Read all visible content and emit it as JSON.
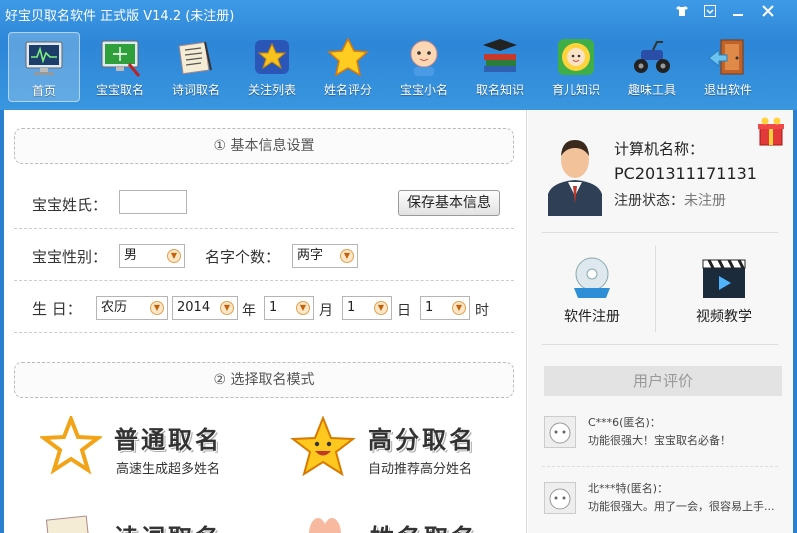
{
  "window": {
    "title": "好宝贝取名软件  正式版 V14.2  (未注册)",
    "controls": [
      "shirt-icon",
      "menu-icon",
      "minimize-icon",
      "close-icon"
    ]
  },
  "toolbar": [
    {
      "label": "首页",
      "icon": "monitor-chart-icon",
      "active": true
    },
    {
      "label": "宝宝取名",
      "icon": "monitor-pen-icon",
      "active": false
    },
    {
      "label": "诗词取名",
      "icon": "scroll-pen-icon",
      "active": false
    },
    {
      "label": "关注列表",
      "icon": "star-badge-icon",
      "active": false
    },
    {
      "label": "姓名评分",
      "icon": "gold-star-icon",
      "active": false
    },
    {
      "label": "宝宝小名",
      "icon": "baby-face-icon",
      "active": false
    },
    {
      "label": "取名知识",
      "icon": "books-icon",
      "active": false
    },
    {
      "label": "育儿知识",
      "icon": "sunflower-baby-icon",
      "active": false
    },
    {
      "label": "趣味工具",
      "icon": "atv-icon",
      "active": false
    },
    {
      "label": "退出软件",
      "icon": "exit-door-icon",
      "active": false
    }
  ],
  "basic": {
    "section_title": "① 基本信息设置",
    "surname_label": "宝宝姓氏：",
    "surname_value": "",
    "save_button": "保存基本信息",
    "gender_label": "宝宝性别：",
    "gender_value": "男",
    "name_count_label": "名字个数：",
    "name_count_value": "两字",
    "birth_label": "生 日：",
    "calendar_value": "农历",
    "year_value": "2014",
    "year_unit": "年",
    "month_value": "1",
    "month_unit": "月",
    "day_value": "1",
    "day_unit": "日",
    "hour_value": "1",
    "hour_unit": "时"
  },
  "mode": {
    "section_title": "② 选择取名模式",
    "normal_title": "普通取名",
    "normal_desc": "高速生成超多姓名",
    "high_title": "高分取名",
    "high_desc": "自动推荐高分姓名",
    "poem_title_partial": "诗词取名",
    "rank_title_partial": "姓名取名"
  },
  "side": {
    "computer_label": "计算机名称：",
    "computer_name": "PC201311171131",
    "reg_label": "注册状态：",
    "reg_value": "未注册",
    "register_label": "软件注册",
    "video_label": "视频教学",
    "review_header": "用户评价",
    "comments": [
      {
        "name": "C***6(匿名)：",
        "text": "功能很强大！宝宝取名必备！"
      },
      {
        "name": "北***特(匿名)：",
        "text": "功能很强大。用了一会，很容易上手..."
      }
    ]
  }
}
